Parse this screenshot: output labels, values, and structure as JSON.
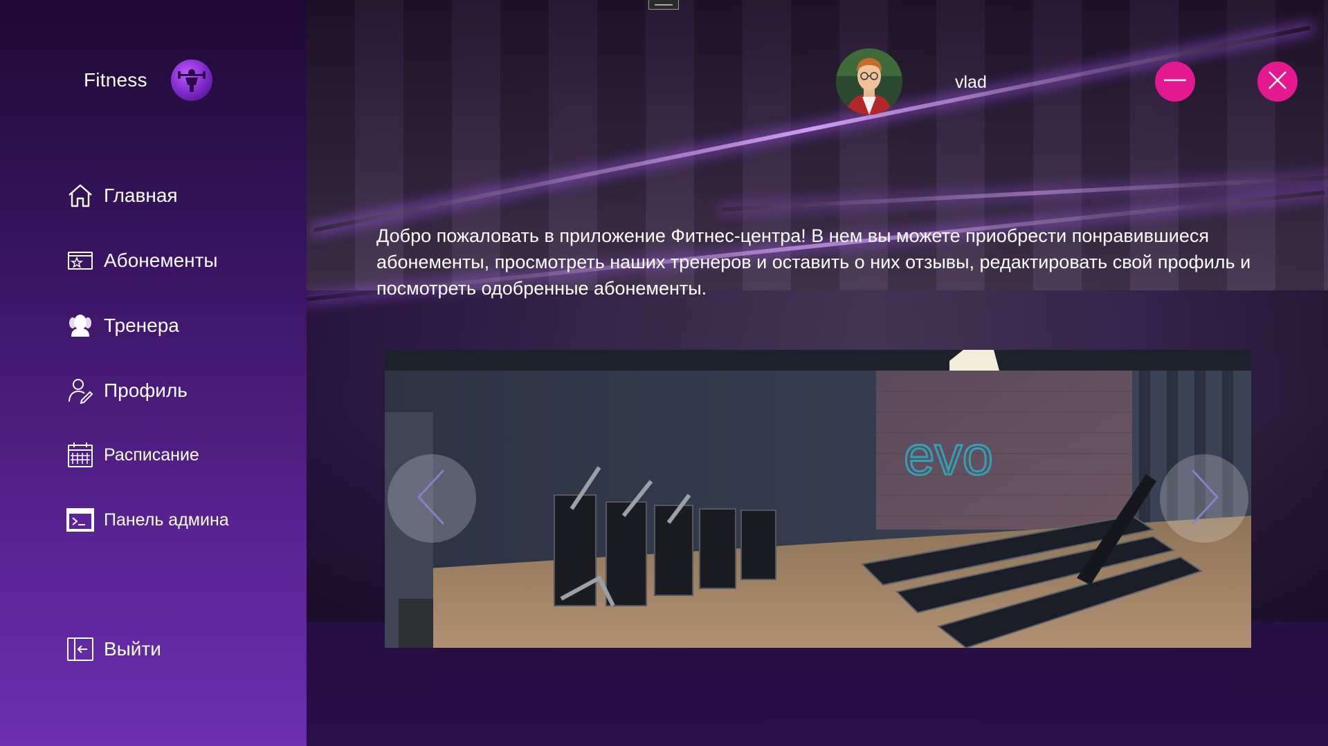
{
  "app": {
    "title": "Fitness"
  },
  "sidebar": {
    "items": [
      {
        "label": "Главная",
        "icon": "home-icon"
      },
      {
        "label": "Абонементы",
        "icon": "membership-card-icon"
      },
      {
        "label": "Тренера",
        "icon": "trainers-icon"
      },
      {
        "label": "Профиль",
        "icon": "profile-icon"
      },
      {
        "label": "Расписание",
        "icon": "calendar-icon"
      },
      {
        "label": "Панель админа",
        "icon": "admin-console-icon"
      }
    ],
    "logout_label": "Выйти"
  },
  "header": {
    "username": "vlad",
    "minimize_icon": "minimize-icon",
    "close_icon": "close-icon"
  },
  "main": {
    "welcome_text": "Добро пожаловать в приложение Фитнес-центра! В нем вы можете приобрести понравившиеся абонементы, просмотреть наших тренеров и оставить о них отзывы, редактировать свой профиль и посмотреть одобренные абонементы.",
    "carousel": {
      "sign_text": "evo",
      "prev_icon": "chevron-left-icon",
      "next_icon": "chevron-right-icon"
    }
  },
  "colors": {
    "accent": "#e4188f",
    "sidebar_top": "#1e0a33",
    "sidebar_bottom": "#6b2fb0"
  }
}
